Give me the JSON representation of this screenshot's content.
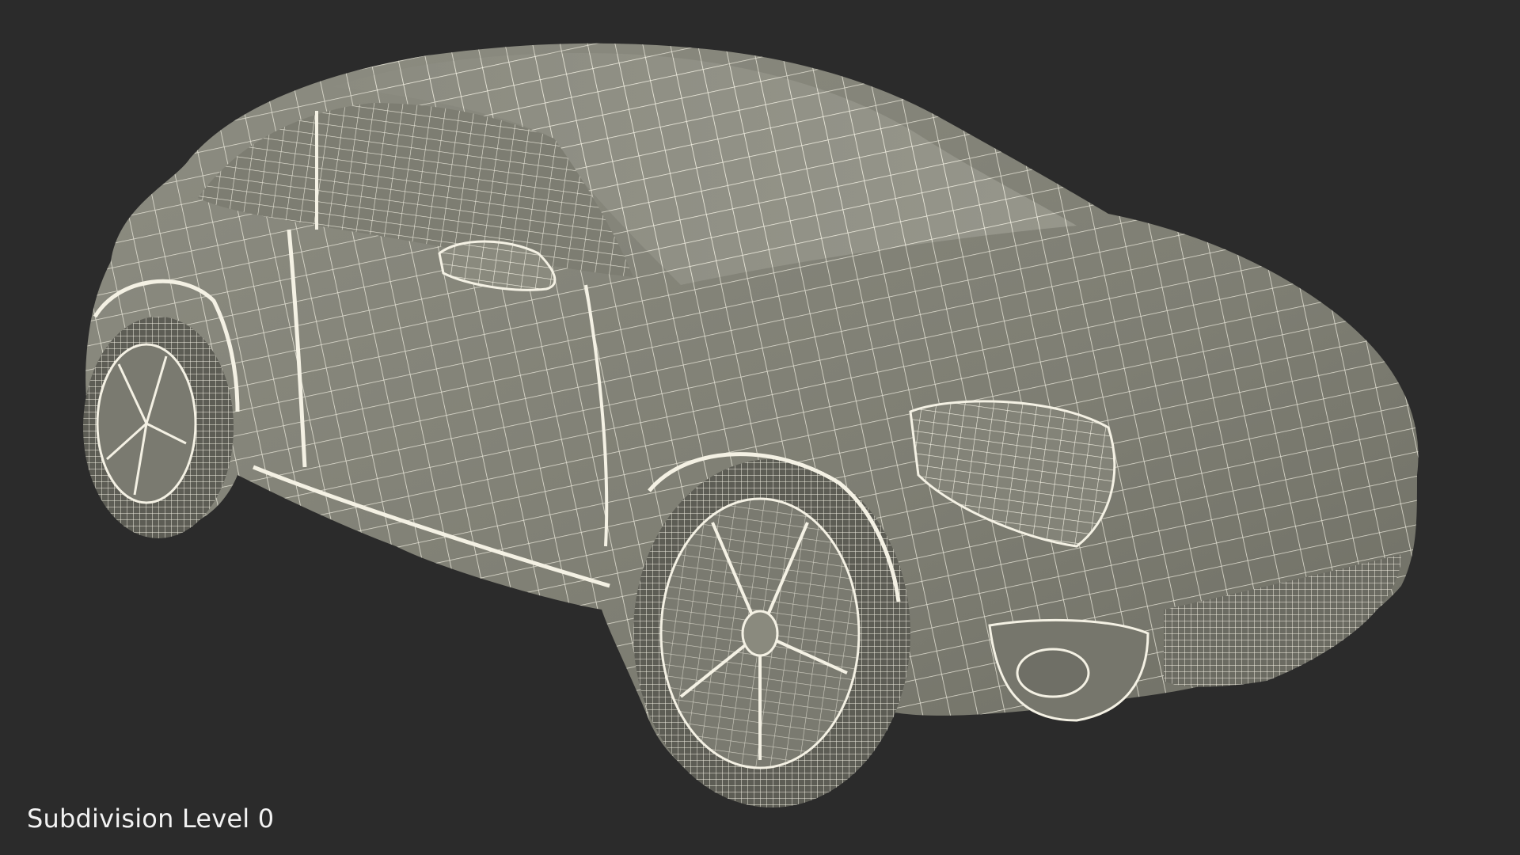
{
  "scene": {
    "background_color": "#2b2b2b",
    "model_fill_color": "#8a8a7e",
    "wire_color": "#f4f1e4",
    "subject": "wireframe-car-model"
  },
  "caption": {
    "text": "Subdivision Level 0"
  }
}
